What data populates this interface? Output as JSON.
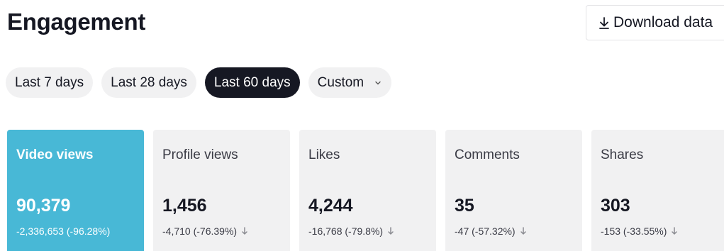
{
  "header": {
    "title": "Engagement",
    "download_label": "Download data"
  },
  "filters": [
    {
      "label": "Last 7 days",
      "active": false
    },
    {
      "label": "Last 28 days",
      "active": false
    },
    {
      "label": "Last 60 days",
      "active": true
    },
    {
      "label": "Custom",
      "active": false,
      "dropdown": true
    }
  ],
  "metrics": [
    {
      "label": "Video views",
      "value": "90,379",
      "change": "-2,336,653 (-96.28%)",
      "selected": true,
      "trend": "down"
    },
    {
      "label": "Profile views",
      "value": "1,456",
      "change": "-4,710 (-76.39%)",
      "selected": false,
      "trend": "down"
    },
    {
      "label": "Likes",
      "value": "4,244",
      "change": "-16,768 (-79.8%)",
      "selected": false,
      "trend": "down"
    },
    {
      "label": "Comments",
      "value": "35",
      "change": "-47 (-57.32%)",
      "selected": false,
      "trend": "down"
    },
    {
      "label": "Shares",
      "value": "303",
      "change": "-153 (-33.55%)",
      "selected": false,
      "trend": "down"
    }
  ],
  "icons": {
    "download": "download-icon",
    "dropdown": "chevron-down-icon",
    "trend_down": "arrow-down-icon"
  },
  "colors": {
    "accent": "#48b8d6",
    "chip_active": "#161823",
    "card_bg": "#f1f1f2"
  }
}
